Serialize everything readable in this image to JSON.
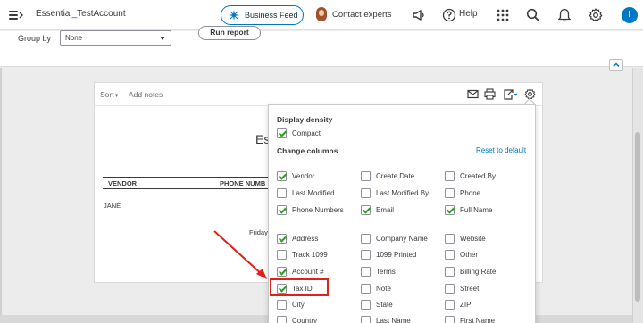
{
  "header": {
    "account_name": "Essential_TestAccount",
    "business_feed_label": "Business Feed",
    "contact_label": "Contact experts",
    "help_label": "Help",
    "user_initial": "I"
  },
  "filters": {
    "group_by_label": "Group by",
    "group_by_value": "None",
    "run_report_label": "Run report"
  },
  "report": {
    "sort_label": "Sort",
    "add_notes_label": "Add notes",
    "title_fragment": "Ess",
    "columns": [
      "VENDOR",
      "PHONE NUMB"
    ],
    "rows": [
      "JANE"
    ],
    "footer_fragment": "Friday"
  },
  "panel": {
    "display_density_title": "Display density",
    "compact_label": "Compact",
    "compact_checked": true,
    "change_columns_title": "Change columns",
    "reset_label": "Reset to default",
    "columns": [
      [
        {
          "label": "Vendor",
          "checked": true
        },
        {
          "label": "Last Modified",
          "checked": false
        },
        {
          "label": "Phone Numbers",
          "checked": true
        },
        {
          "label": "Address",
          "checked": true
        },
        {
          "label": "Track 1099",
          "checked": false
        },
        {
          "label": "Account #",
          "checked": true
        },
        {
          "label": "Tax ID",
          "checked": true
        },
        {
          "label": "City",
          "checked": false
        },
        {
          "label": "Country",
          "checked": false
        }
      ],
      [
        {
          "label": "Create Date",
          "checked": false
        },
        {
          "label": "Last Modified By",
          "checked": false
        },
        {
          "label": "Email",
          "checked": true
        },
        {
          "label": "Company Name",
          "checked": false
        },
        {
          "label": "1099 Printed",
          "checked": false
        },
        {
          "label": "Terms",
          "checked": false
        },
        {
          "label": "Note",
          "checked": false
        },
        {
          "label": "State",
          "checked": false
        },
        {
          "label": "Last Name",
          "checked": false
        }
      ],
      [
        {
          "label": "Created By",
          "checked": false
        },
        {
          "label": "Phone",
          "checked": false
        },
        {
          "label": "Full Name",
          "checked": true
        },
        {
          "label": "Website",
          "checked": false
        },
        {
          "label": "Other",
          "checked": false
        },
        {
          "label": "Billing Rate",
          "checked": false
        },
        {
          "label": "Street",
          "checked": false
        },
        {
          "label": "ZIP",
          "checked": false
        },
        {
          "label": "First Name",
          "checked": false
        }
      ]
    ]
  },
  "colors": {
    "accent": "#0077c5",
    "check": "#2ca01c",
    "annotation": "#e0201a"
  }
}
